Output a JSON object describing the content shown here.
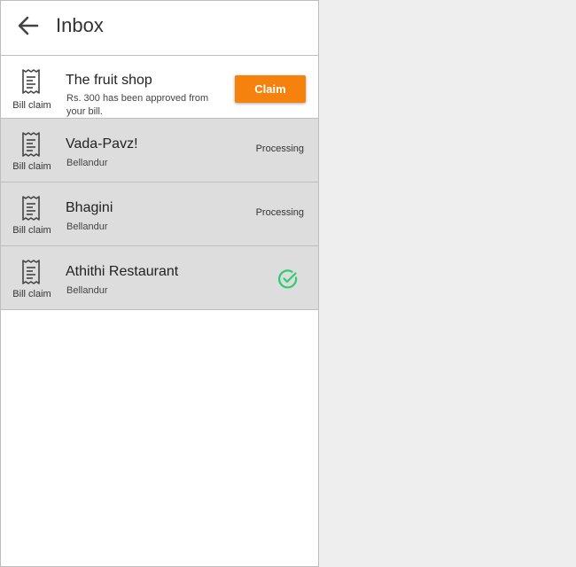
{
  "header": {
    "title": "Inbox",
    "back_icon": "arrow-left-icon"
  },
  "colors": {
    "accent": "#f5820d",
    "success": "#2ecc71",
    "row_grey": "#dddddd"
  },
  "items": [
    {
      "icon": "receipt-icon",
      "icon_label": "Bill claim",
      "name": "The fruit shop",
      "subtitle": "Rs. 300 has been approved from your bill.",
      "action_label": "Claim"
    },
    {
      "icon": "receipt-icon",
      "icon_label": "Bill claim",
      "name": "Vada-Pavz!",
      "subtitle": "Bellandur",
      "status": "Processing"
    },
    {
      "icon": "receipt-icon",
      "icon_label": "Bill claim",
      "name": "Bhagini",
      "subtitle": "Bellandur",
      "status": "Processing"
    },
    {
      "icon": "receipt-icon",
      "icon_label": "Bill claim",
      "name": "Athithi Restaurant",
      "subtitle": "Bellandur",
      "status_icon": "check-circle-icon"
    }
  ]
}
